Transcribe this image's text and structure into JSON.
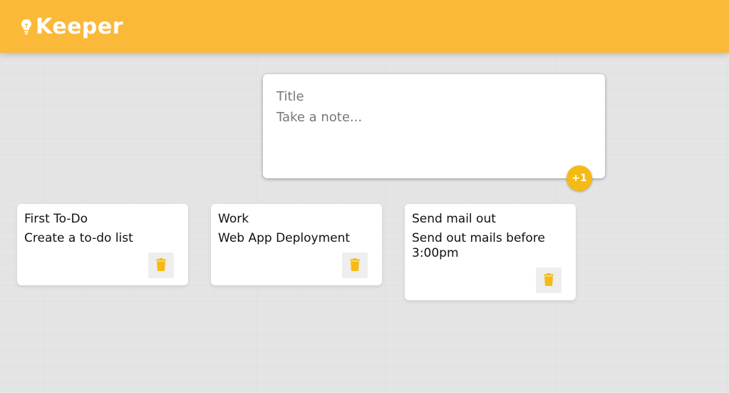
{
  "header": {
    "brand": "Keeper",
    "icon": "lightbulb-icon"
  },
  "create_note": {
    "title_placeholder": "Title",
    "content_placeholder": "Take a note...",
    "add_label": "+1"
  },
  "notes": [
    {
      "title": "First To-Do",
      "content": "Create a to-do list",
      "delete_icon": "trash-icon"
    },
    {
      "title": "Work",
      "content": "Web App Deployment",
      "delete_icon": "trash-icon"
    },
    {
      "title": "Send mail out",
      "content": "Send out mails before 3:00pm",
      "delete_icon": "trash-icon"
    }
  ],
  "colors": {
    "header_bg": "#fbb939",
    "accent": "#f5ba13",
    "background": "#e4e4e4",
    "card": "#ffffff"
  }
}
